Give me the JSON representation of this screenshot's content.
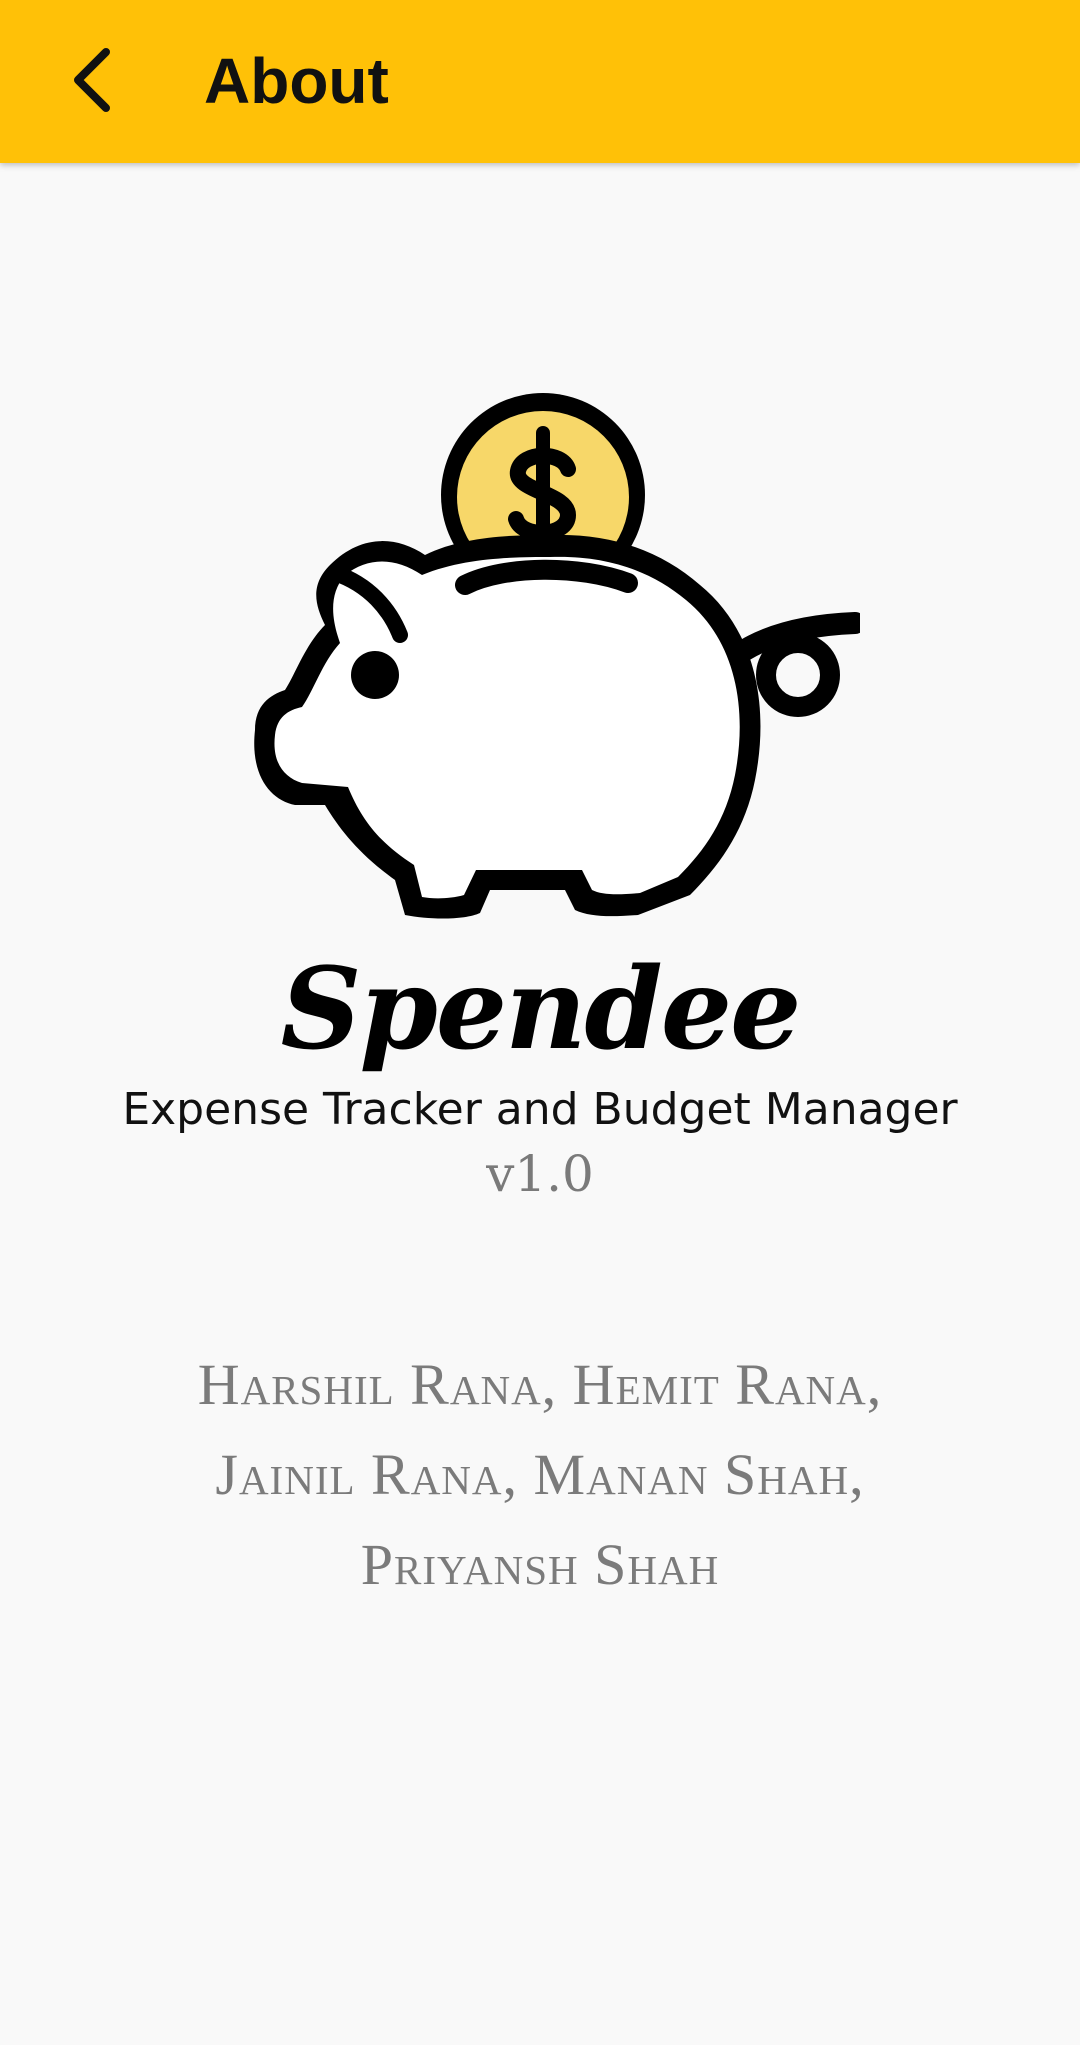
{
  "header": {
    "title": "About",
    "back_icon": "chevron-left-icon",
    "background_color": "#ffc107"
  },
  "logo": {
    "icon": "piggy-bank-coin-icon",
    "coin_color": "#f7d769"
  },
  "app": {
    "name": "Spendee",
    "tagline": "Expense Tracker and Budget Manager",
    "version": "v1.0"
  },
  "credits": {
    "line1": "Harshil Rana, Hemit Rana,",
    "line2": "Jainil Rana, Manan Shah,",
    "line3": "Priyansh Shah"
  }
}
